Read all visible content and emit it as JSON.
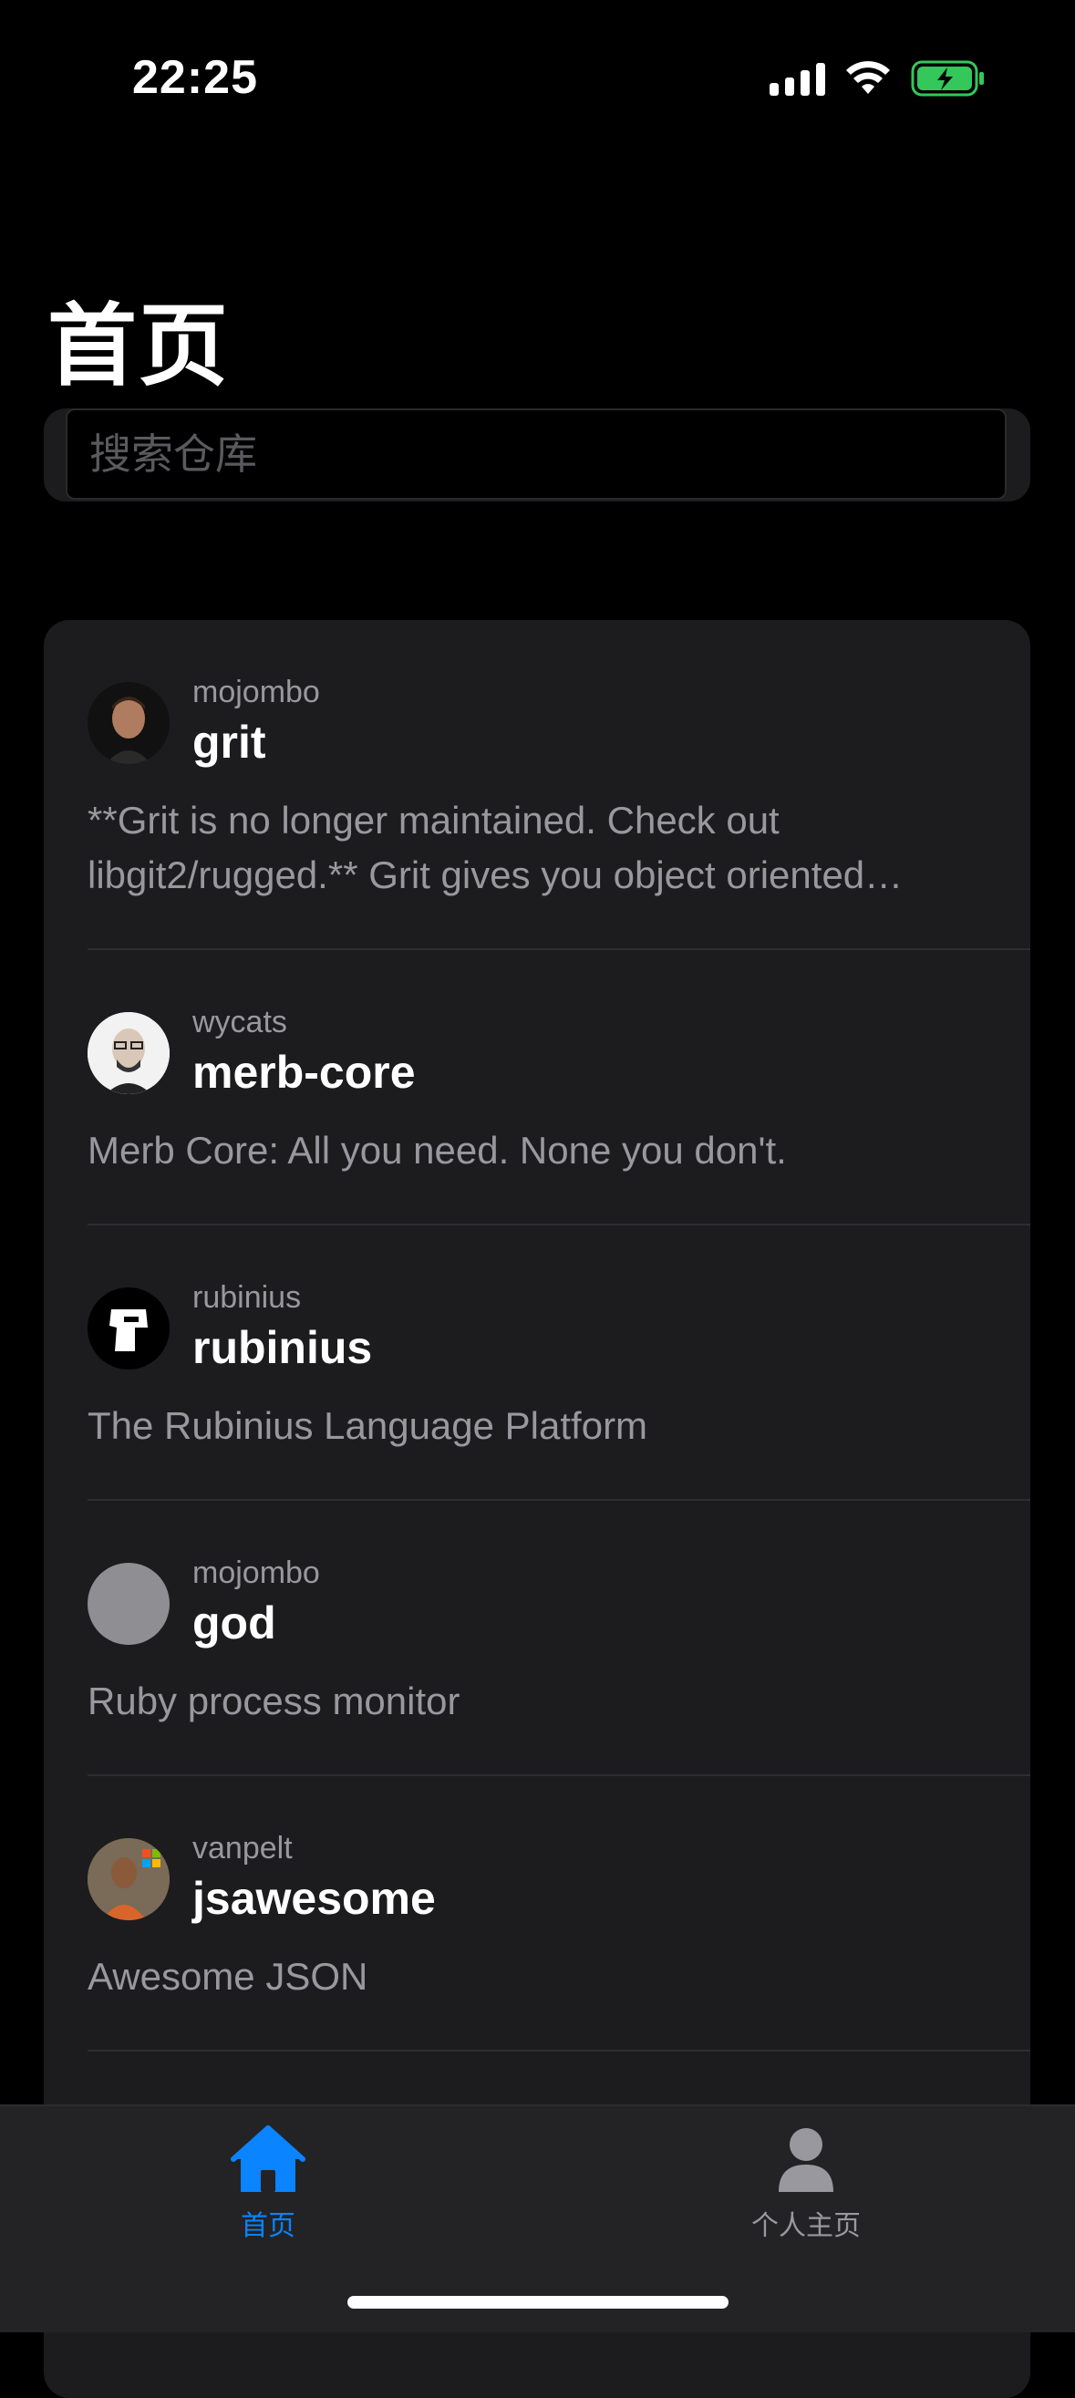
{
  "status_bar": {
    "time": "22:25",
    "icons": [
      "signal-icon",
      "wifi-icon",
      "battery-charging-icon"
    ],
    "battery_color": "#34c759"
  },
  "header": {
    "title": "首页"
  },
  "search": {
    "placeholder": "搜索仓库",
    "value": ""
  },
  "repos": [
    {
      "owner": "mojombo",
      "name": "grit",
      "description": "**Grit is no longer maintained. Check out libgit2/rugged.** Grit gives you object oriented read/write access to Git repositories via Ruby.",
      "avatar": "photo-avatar"
    },
    {
      "owner": "wycats",
      "name": "merb-core",
      "description": "Merb Core: All you need. None you don't.",
      "avatar": "photo-avatar"
    },
    {
      "owner": "rubinius",
      "name": "rubinius",
      "description": "The Rubinius Language Platform",
      "avatar": "logo-avatar"
    },
    {
      "owner": "mojombo",
      "name": "god",
      "description": "Ruby process monitor",
      "avatar": "placeholder-avatar"
    },
    {
      "owner": "vanpelt",
      "name": "jsawesome",
      "description": "Awesome JSON",
      "avatar": "photo-avatar"
    }
  ],
  "tab_bar": {
    "tabs": [
      {
        "label": "首页",
        "icon": "house-icon",
        "active": true
      },
      {
        "label": "个人主页",
        "icon": "person-icon",
        "active": false
      }
    ],
    "active_color": "#0a84ff",
    "inactive_color": "#98989e"
  }
}
